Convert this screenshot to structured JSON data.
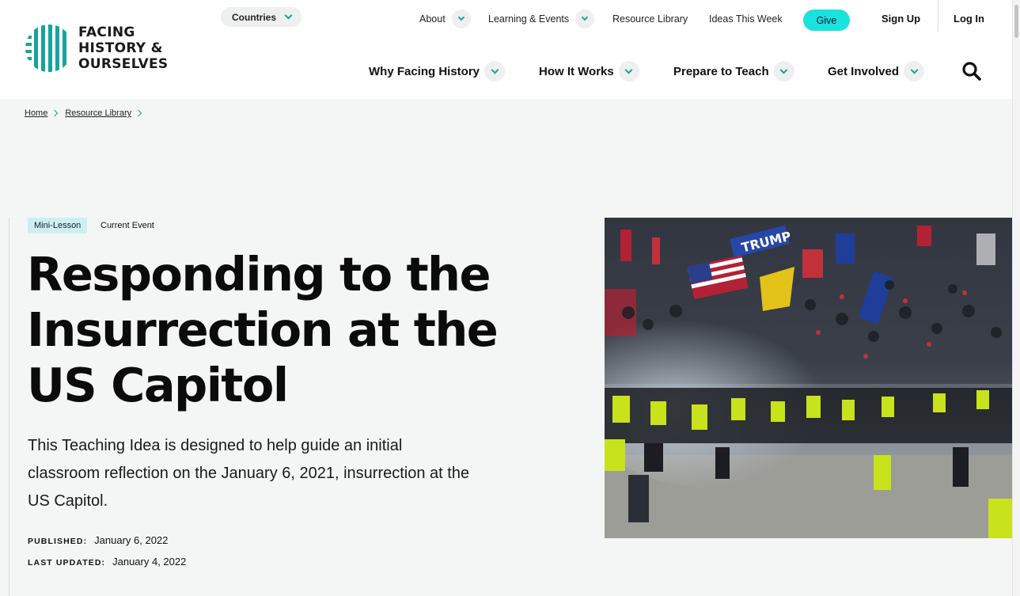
{
  "header": {
    "logo": {
      "line1": "FACING",
      "line2": "HISTORY &",
      "line3": "OURSELVES"
    },
    "countries_label": "Countries",
    "utility_nav": [
      {
        "label": "About",
        "has_dropdown": true
      },
      {
        "label": "Learning & Events",
        "has_dropdown": true
      },
      {
        "label": "Resource Library",
        "has_dropdown": false
      },
      {
        "label": "Ideas This Week",
        "has_dropdown": false
      }
    ],
    "give_label": "Give",
    "signup_label": "Sign Up",
    "login_label": "Log In",
    "main_nav": [
      {
        "label": "Why Facing History"
      },
      {
        "label": "How It Works"
      },
      {
        "label": "Prepare to Teach"
      },
      {
        "label": "Get Involved"
      }
    ]
  },
  "breadcrumb": [
    "Home",
    "Resource Library"
  ],
  "article": {
    "tags": {
      "type": "Mini-Lesson",
      "category": "Current Event"
    },
    "title_lines": [
      "Responding to the",
      "Insurrection at the",
      "US Capitol"
    ],
    "description_lines": [
      "This Teaching Idea is designed to help guide an initial",
      "classroom reflection on the January 6, 2021, insurrection at the",
      "US Capitol."
    ],
    "published_label": "PUBLISHED:",
    "published_value": "January 6, 2022",
    "updated_label": "LAST UPDATED:",
    "updated_value": "January 4, 2022"
  },
  "image": {
    "flag_text_1": "TRUMP"
  },
  "colors": {
    "brand_teal": "#18a39c",
    "give_button": "#19e3dc",
    "tag_background": "#cdeff0",
    "page_background": "#f4f6f5"
  },
  "icons": [
    "chevron-down-icon",
    "search-icon",
    "chevron-right-icon"
  ]
}
